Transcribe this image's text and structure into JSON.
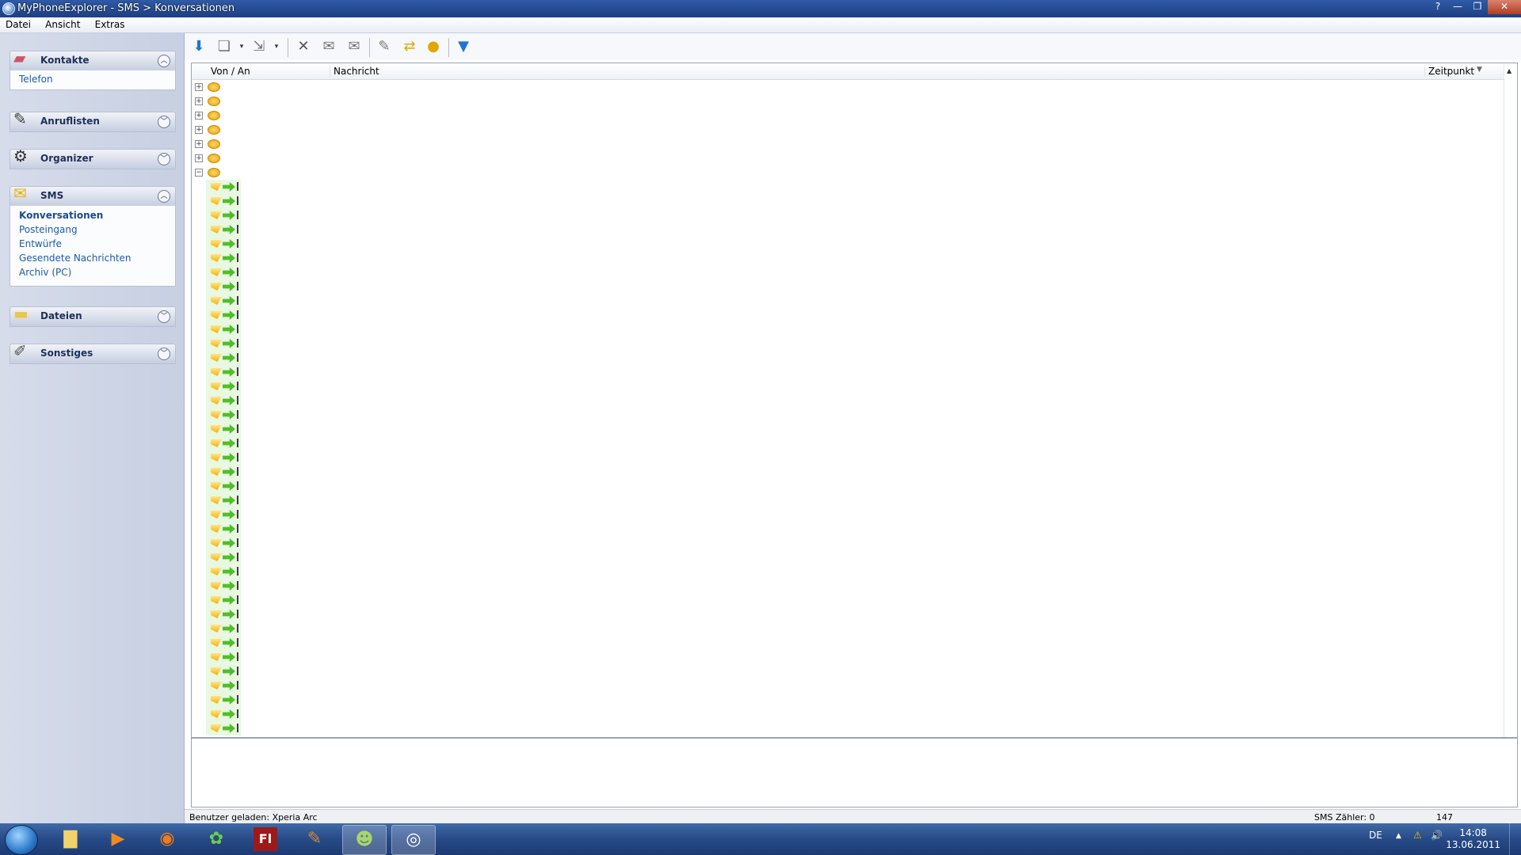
{
  "window": {
    "title": "MyPhoneExplorer -  SMS > Konversationen",
    "buttons": {
      "help": "?",
      "minimize": "—",
      "restore": "❐",
      "close": "✕"
    }
  },
  "menu": [
    "Datei",
    "Ansicht",
    "Extras"
  ],
  "sidebar": {
    "kontakte": {
      "label": "Kontakte",
      "items": [
        "Telefon"
      ],
      "expanded": true
    },
    "anruflisten": {
      "label": "Anruflisten",
      "expanded": false
    },
    "organizer": {
      "label": "Organizer",
      "expanded": false
    },
    "sms": {
      "label": "SMS",
      "expanded": true,
      "items": [
        "Konversationen",
        "Posteingang",
        "Entwürfe",
        "Gesendete Nachrichten",
        "Archiv (PC)"
      ],
      "active": "Konversationen"
    },
    "dateien": {
      "label": "Dateien",
      "expanded": false
    },
    "sonstiges": {
      "label": "Sonstiges",
      "expanded": false
    }
  },
  "toolbar": {
    "icons": [
      "download-arrow-icon",
      "copy-icon",
      "export-icon",
      "delete-icon",
      "reply-icon",
      "forward-icon",
      "edit-icon",
      "sync-icon",
      "new-sms-icon",
      "filter-icon"
    ]
  },
  "grid": {
    "columns": {
      "from_to": "Von / An",
      "message": "Nachricht",
      "time": "Zeitpunkt"
    },
    "collapsed_conversations": 6,
    "expanded_conversation_messages": 39
  },
  "status": {
    "user": "Benutzer geladen: Xperia Arc",
    "sms_counter": "SMS Zähler: 0",
    "count": "147"
  },
  "taskbar": {
    "tray": {
      "language": "DE",
      "time": "14:08",
      "date": "13.06.2011"
    }
  },
  "colors": {
    "titlebar": "#2f5aa6",
    "link": "#1c5ba8",
    "sidebar": "#d6dcea",
    "taskbar": "#274a86"
  }
}
